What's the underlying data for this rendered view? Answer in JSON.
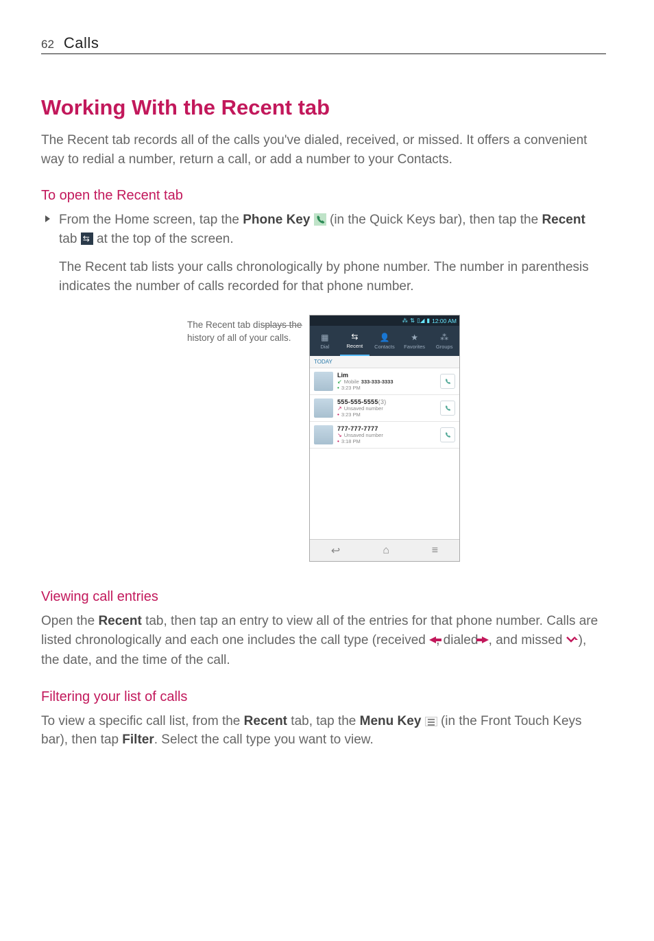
{
  "header": {
    "page_number": "62",
    "section": "Calls"
  },
  "title": "Working With the Recent tab",
  "intro": "The Recent tab records all of the calls you've dialed, received, or missed. It offers a convenient way to redial a number, return a call, or add a number to your Contacts.",
  "open_heading": "To open the Recent tab",
  "open_bullet_pre": "From the Home screen, tap the ",
  "open_bullet_phonekey": "Phone Key",
  "open_bullet_mid": " (in the Quick Keys bar), then tap the ",
  "open_bullet_recent": "Recent",
  "open_bullet_post": " tab ",
  "open_bullet_end": " at the top of the screen.",
  "open_para": "The Recent tab lists your calls chronologically by phone number. The number in parenthesis indicates the number of calls recorded for that phone number.",
  "caption": "The Recent tab displays the history of all of your calls.",
  "phone": {
    "status_time": "12:00 AM",
    "tabs": [
      "Dial",
      "Recent",
      "Contacts",
      "Favorites",
      "Groups"
    ],
    "today_label": "TODAY",
    "rows": [
      {
        "name": "Lim",
        "sub_prefix": "Mobile",
        "number": "333-333-3333",
        "time_prefix": "",
        "time": "3:23 PM",
        "dir": "in"
      },
      {
        "name": "555-555-5555",
        "count": "(3)",
        "sub_prefix": "Unsaved number",
        "number": "",
        "time_prefix": "",
        "time": "3:23 PM",
        "dir": "out"
      },
      {
        "name": "777-777-7777",
        "sub_prefix": "Unsaved number",
        "number": "",
        "time_prefix": "",
        "time": "3:18 PM",
        "dir": "miss"
      }
    ]
  },
  "viewing_heading": "Viewing call entries",
  "viewing_para_pre": "Open the ",
  "viewing_recent": "Recent",
  "viewing_para_mid1": " tab, then tap an entry to view all of the entries for that phone number. Calls are listed chronologically and each one includes the call type (received ",
  "viewing_para_mid2": ", dialed ",
  "viewing_para_mid3": ", and missed ",
  "viewing_para_end": "), the date, and the time of the call.",
  "filter_heading": "Filtering your list of calls",
  "filter_para_pre": "To view a specific call list, from the ",
  "filter_recent": "Recent",
  "filter_para_mid1": " tab, tap the ",
  "filter_menukey": "Menu Key",
  "filter_para_mid2": " (in the Front Touch Keys bar), then tap ",
  "filter_filter": "Filter",
  "filter_para_end": ". Select the call type you want to view."
}
